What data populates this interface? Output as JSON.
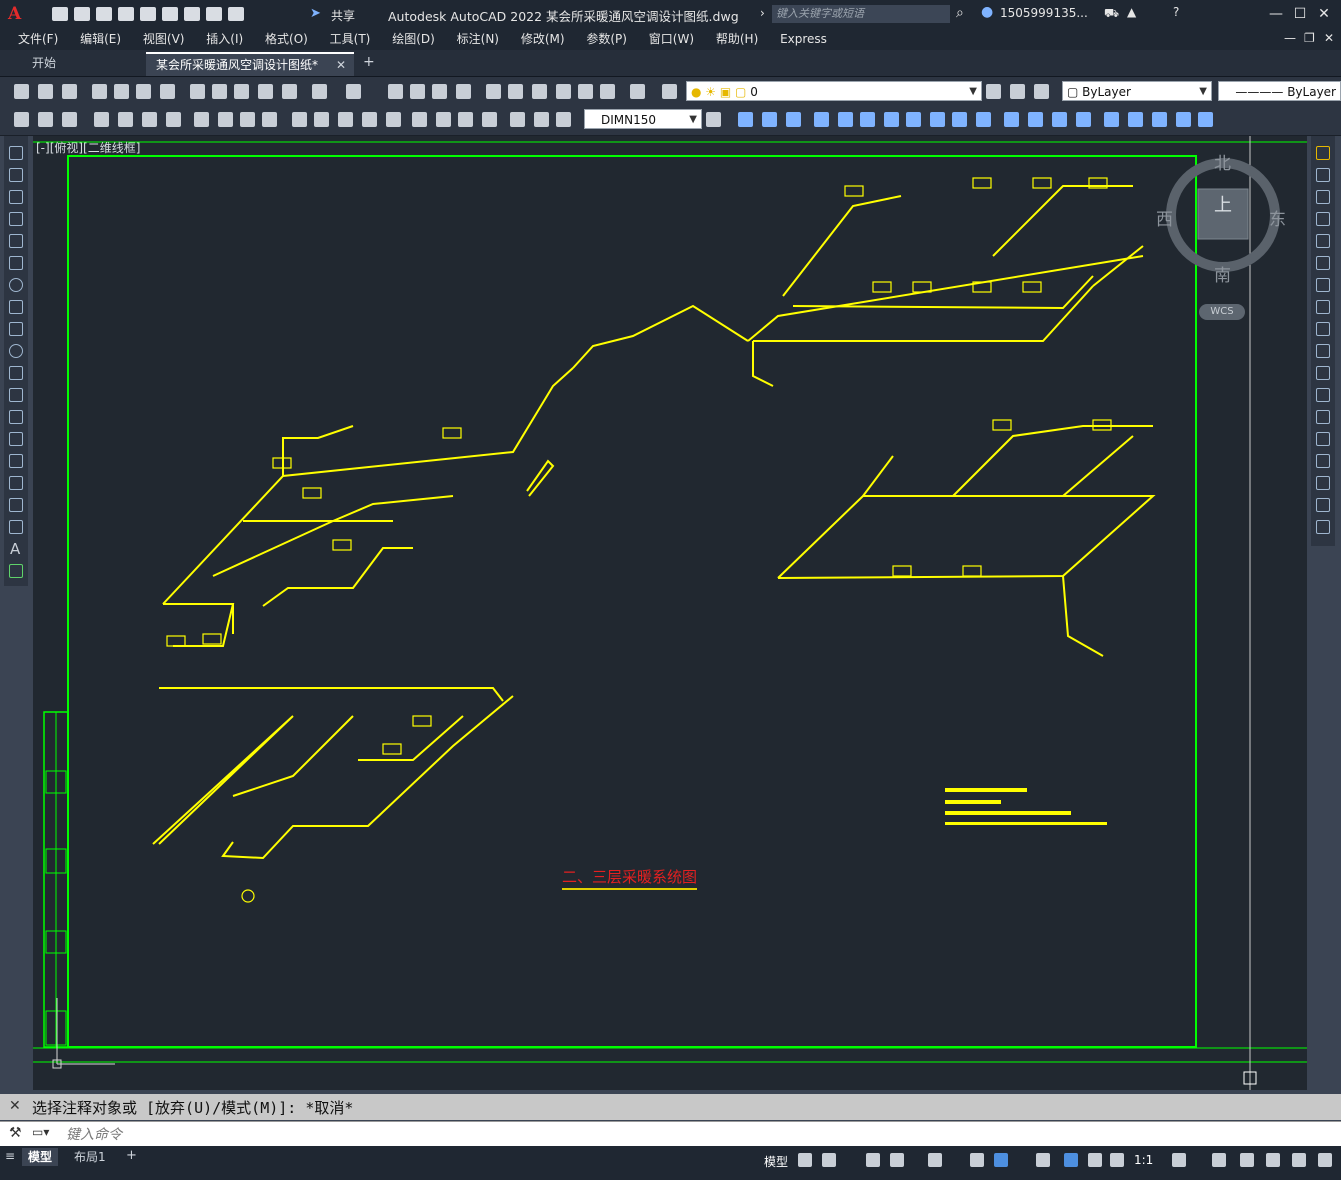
{
  "app": {
    "title": "Autodesk AutoCAD 2022    某会所采暖通风空调设计图纸.dwg",
    "share_label": "共享",
    "search_placeholder": "键入关键字或短语",
    "user": "1505999135...",
    "logo": "A"
  },
  "menu": [
    "文件(F)",
    "编辑(E)",
    "视图(V)",
    "插入(I)",
    "格式(O)",
    "工具(T)",
    "绘图(D)",
    "标注(N)",
    "修改(M)",
    "参数(P)",
    "窗口(W)",
    "帮助(H)",
    "Express"
  ],
  "tabs": {
    "start": "开始",
    "file": "某会所采暖通风空调设计图纸*"
  },
  "toolbar": {
    "layer_value": "0",
    "color_value": "ByLayer",
    "linetype_value": "ByLayer",
    "dimstyle_value": "DIMN150"
  },
  "viewport": {
    "label": "[-][俯视][二维线框]",
    "compass": {
      "top": "上",
      "north": "北",
      "south": "南",
      "east": "东",
      "west": "西"
    },
    "wcs": "WCS"
  },
  "drawing": {
    "title": "二、三层采暖系统图",
    "line_color": "#ffff00",
    "border_color": "#00ff00",
    "title_color": "#e32020"
  },
  "command": {
    "history": "选择注释对象或 [放弃(U)/模式(M)]: *取消*",
    "placeholder": "键入命令"
  },
  "status": {
    "model_tab": "模型",
    "layout_tab": "布局1",
    "model_button": "模型",
    "scale": "1:1"
  }
}
